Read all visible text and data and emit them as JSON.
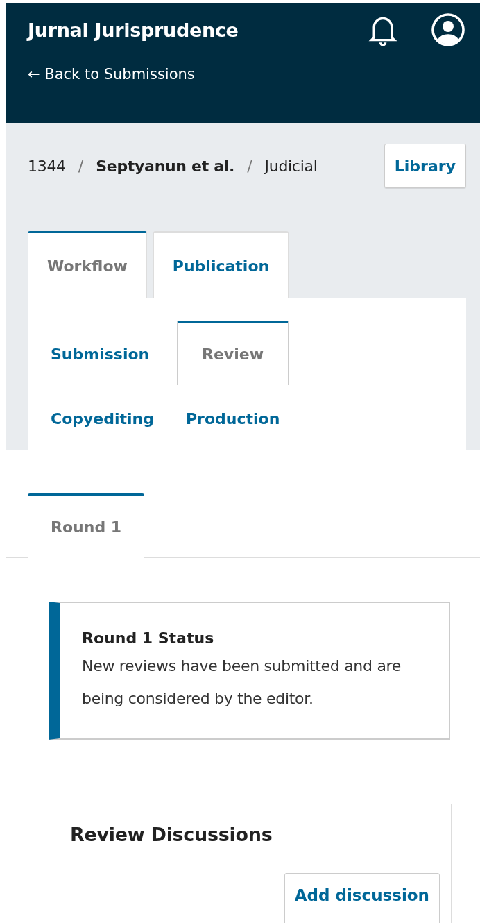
{
  "header": {
    "title": "Jurnal Jurisprudence",
    "back_link": "← Back to Submissions"
  },
  "breadcrumb": [
    {
      "kind": "crumb",
      "text": "1344",
      "bold": false
    },
    {
      "kind": "separator",
      "text": "/"
    },
    {
      "kind": "crumb",
      "text": "Septyanun et al.",
      "bold": true
    },
    {
      "kind": "separator",
      "text": "/"
    },
    {
      "kind": "crumb",
      "text": "Judicial",
      "bold": false
    }
  ],
  "library_button": "Library",
  "tabs": [
    {
      "label": "Workflow",
      "selected": true
    },
    {
      "label": "Publication",
      "selected": false
    }
  ],
  "stage_tabs": [
    {
      "label": "Submission",
      "selected": false
    },
    {
      "label": "Review",
      "selected": true
    },
    {
      "label": "Copyediting",
      "selected": false
    },
    {
      "label": "Production",
      "selected": false
    }
  ],
  "round_tabs": [
    {
      "label": "Round 1",
      "selected": true
    }
  ],
  "status": {
    "title": "Round 1 Status",
    "text": "New reviews have been submitted and are being considered by the editor."
  },
  "discussions": {
    "title": "Review Discussions",
    "button": "Add discussion"
  }
}
